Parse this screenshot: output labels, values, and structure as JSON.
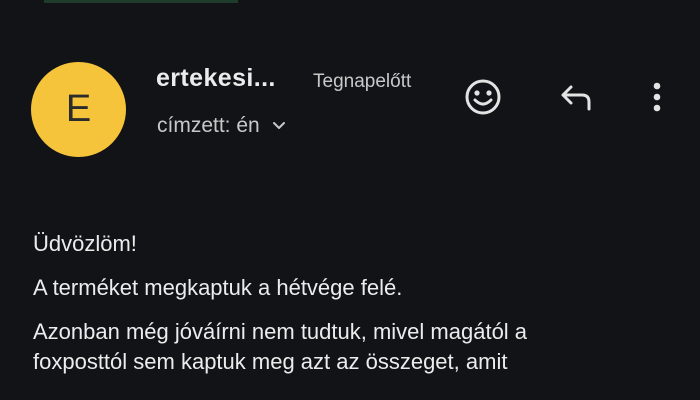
{
  "header": {
    "avatar_letter": "E",
    "sender": "ertekesi...",
    "date": "Tegnapelőtt",
    "recipient": "címzett: én"
  },
  "actions": {
    "emoji_icon": "smiley-icon",
    "reply_icon": "reply-icon",
    "more_icon": "more-vert-icon"
  },
  "body": {
    "greeting": "Üdvözlöm!",
    "line1": "A terméket megkaptuk a hétvége felé.",
    "line2": "Azonban még jóváírni nem tudtuk, mivel magától a\nfoxposttól sem kaptuk meg azt az összeget, amit"
  },
  "colors": {
    "background": "#121317",
    "avatar": "#f6c43b"
  }
}
